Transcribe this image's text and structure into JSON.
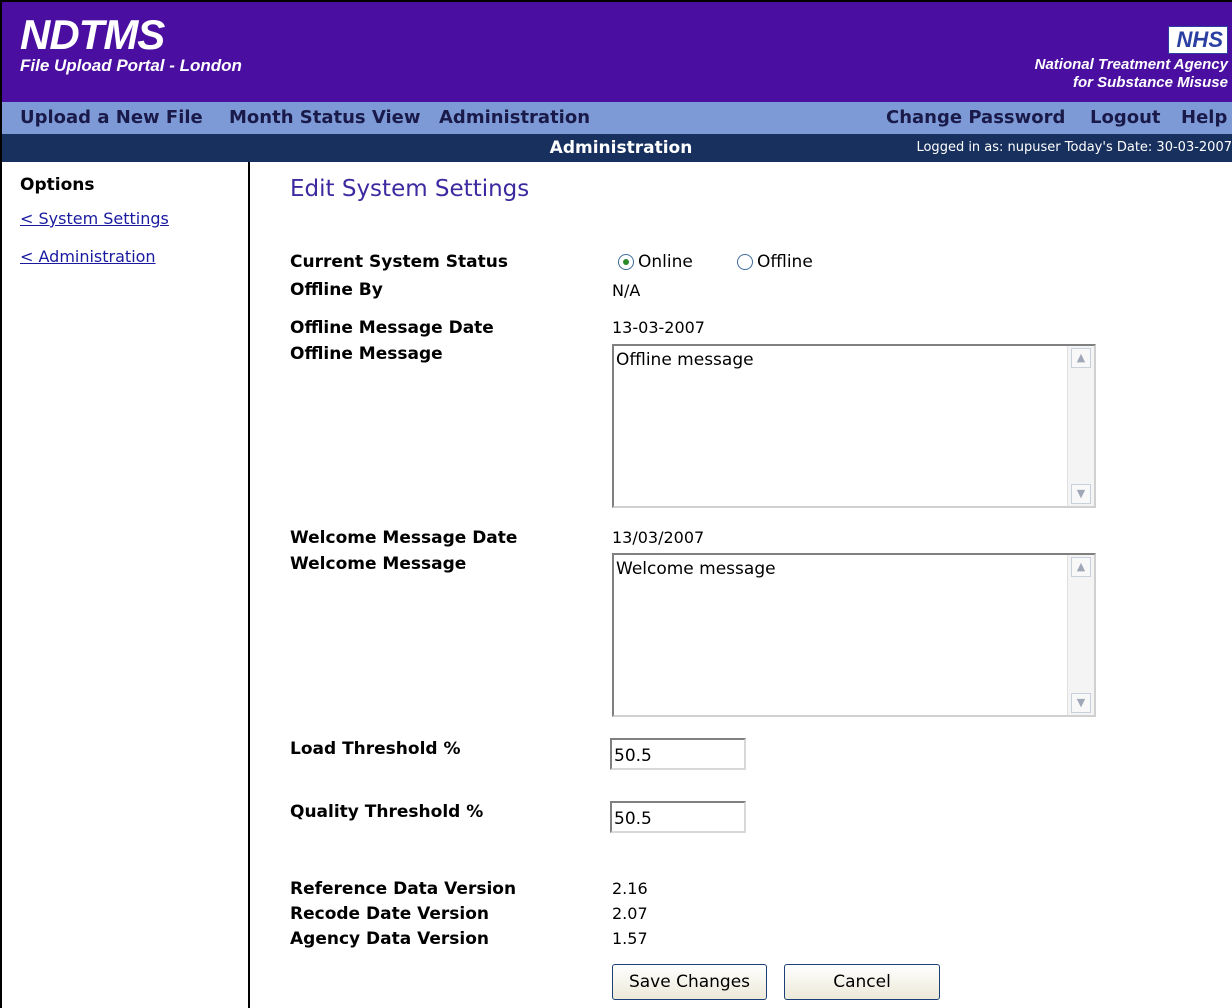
{
  "header": {
    "title": "NDTMS",
    "subtitle": "File Upload Portal - London",
    "nhs_logo": "NHS",
    "agency_line1": "National Treatment Agency",
    "agency_line2": "for Substance Misuse"
  },
  "nav": {
    "upload": "Upload a New File",
    "month_status": "Month Status View",
    "administration": "Administration",
    "change_password": "Change Password",
    "logout": "Logout",
    "help": "Help"
  },
  "subbar": {
    "section": "Administration",
    "logged_in": "Logged in as: nupuser Today's Date: 30-03-2007"
  },
  "sidebar": {
    "heading": "Options",
    "links": [
      "< System Settings",
      "< Administration"
    ]
  },
  "main": {
    "title": "Edit System Settings",
    "status_label": "Current System Status",
    "status_online": "Online",
    "status_offline": "Offline",
    "status_selected": "Online",
    "offline_by_label": "Offline By",
    "offline_by_value": "N/A",
    "offline_msg_date_label": "Offline Message Date",
    "offline_msg_date_value": "13-03-2007",
    "offline_msg_label": "Offline Message",
    "offline_msg_value": "Offline message",
    "welcome_msg_date_label": "Welcome Message Date",
    "welcome_msg_date_value": "13/03/2007",
    "welcome_msg_label": "Welcome Message",
    "welcome_msg_value": "Welcome message",
    "load_threshold_label": "Load Threshold %",
    "load_threshold_value": "50.5",
    "quality_threshold_label": "Quality Threshold %",
    "quality_threshold_value": "50.5",
    "ref_data_label": "Reference Data Version",
    "ref_data_value": "2.16",
    "recode_label": "Recode Date Version",
    "recode_value": "2.07",
    "agency_data_label": "Agency Data Version",
    "agency_data_value": "1.57",
    "save_button": "Save Changes",
    "cancel_button": "Cancel"
  }
}
